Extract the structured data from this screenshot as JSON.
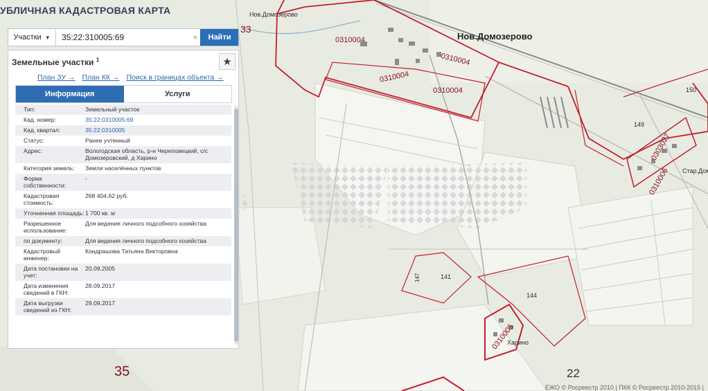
{
  "app": {
    "title": "УБЛИЧНАЯ КАДАСТРОВАЯ КАРТА"
  },
  "search": {
    "type_label": "Участки",
    "value": "35:22:310005:69",
    "clear_icon": "×",
    "find_label": "Найти"
  },
  "panel": {
    "title": "Земельные участки",
    "count": "1",
    "star_icon": "★",
    "links": {
      "plan_zu": "План ЗУ →",
      "plan_kk": "План КК →",
      "search_bounds": "Поиск в границах объекта →"
    },
    "tabs": {
      "info": "Информация",
      "services": "Услуги"
    },
    "rows": [
      {
        "key": "Тип:",
        "value": "Земельный участок"
      },
      {
        "key": "Кад. номер:",
        "value": "35:22:0310005:69"
      },
      {
        "key": "Кад. квартал:",
        "value": "35:22:0310005"
      },
      {
        "key": "Статус:",
        "value": "Ранее учтенный"
      },
      {
        "key": "Адрес:",
        "value": "Вологодская область, р-н Череповецкий, с/с Домозеровский, д Харино"
      },
      {
        "key": "Категория земель:",
        "value": "Земли населённых пунктов"
      },
      {
        "key": "Форма собственности:",
        "value": "-"
      },
      {
        "key": "Кадастровая стоимость:",
        "value": "268 404,62 руб."
      },
      {
        "key": "Уточненная площадь:",
        "value": "1 700 кв. м"
      },
      {
        "key": "Разрешенное использование:",
        "value": "Для ведения личного подсобного хозяйства"
      },
      {
        "key": "по документу:",
        "value": "Для ведения личного подсобного хозяйства"
      },
      {
        "key": "Кадастровый инженер:",
        "value": "Кондрашова Татьяна Викторовна"
      },
      {
        "key": "Дата постановки на учет:",
        "value": "20.09.2005"
      },
      {
        "key": "Дата изменения сведений в ГКН:",
        "value": "28.09.2017"
      },
      {
        "key": "Дата выгрузки сведений из ГКН:",
        "value": "29.09.2017"
      }
    ]
  },
  "map": {
    "labels": {
      "nov_domozerovo_small": "Нов.Домозерово",
      "nov_domozerovo": "Нов.Домозерово",
      "q0310004_a": "0310004",
      "q0310004_b": "0310004",
      "q0310004_c": "0310004",
      "q0310004_d": "0310004",
      "q0303027": "0303027",
      "q0310006": "0310006",
      "q0310005": "0310005",
      "star_domozerovo": "Стар.Домо",
      "kharino": "Харино",
      "n141": "141",
      "n147": "147",
      "n144": "144",
      "n149": "149",
      "n150": "150",
      "n35": "35",
      "n22": "22",
      "n33": "33"
    },
    "footer": "ЕЖО © Росреестр 2010 | ПКК © Росреестр 2010-2015 | "
  },
  "colors": {
    "boundary": "#c41e2e",
    "accent": "#2e6db3"
  }
}
